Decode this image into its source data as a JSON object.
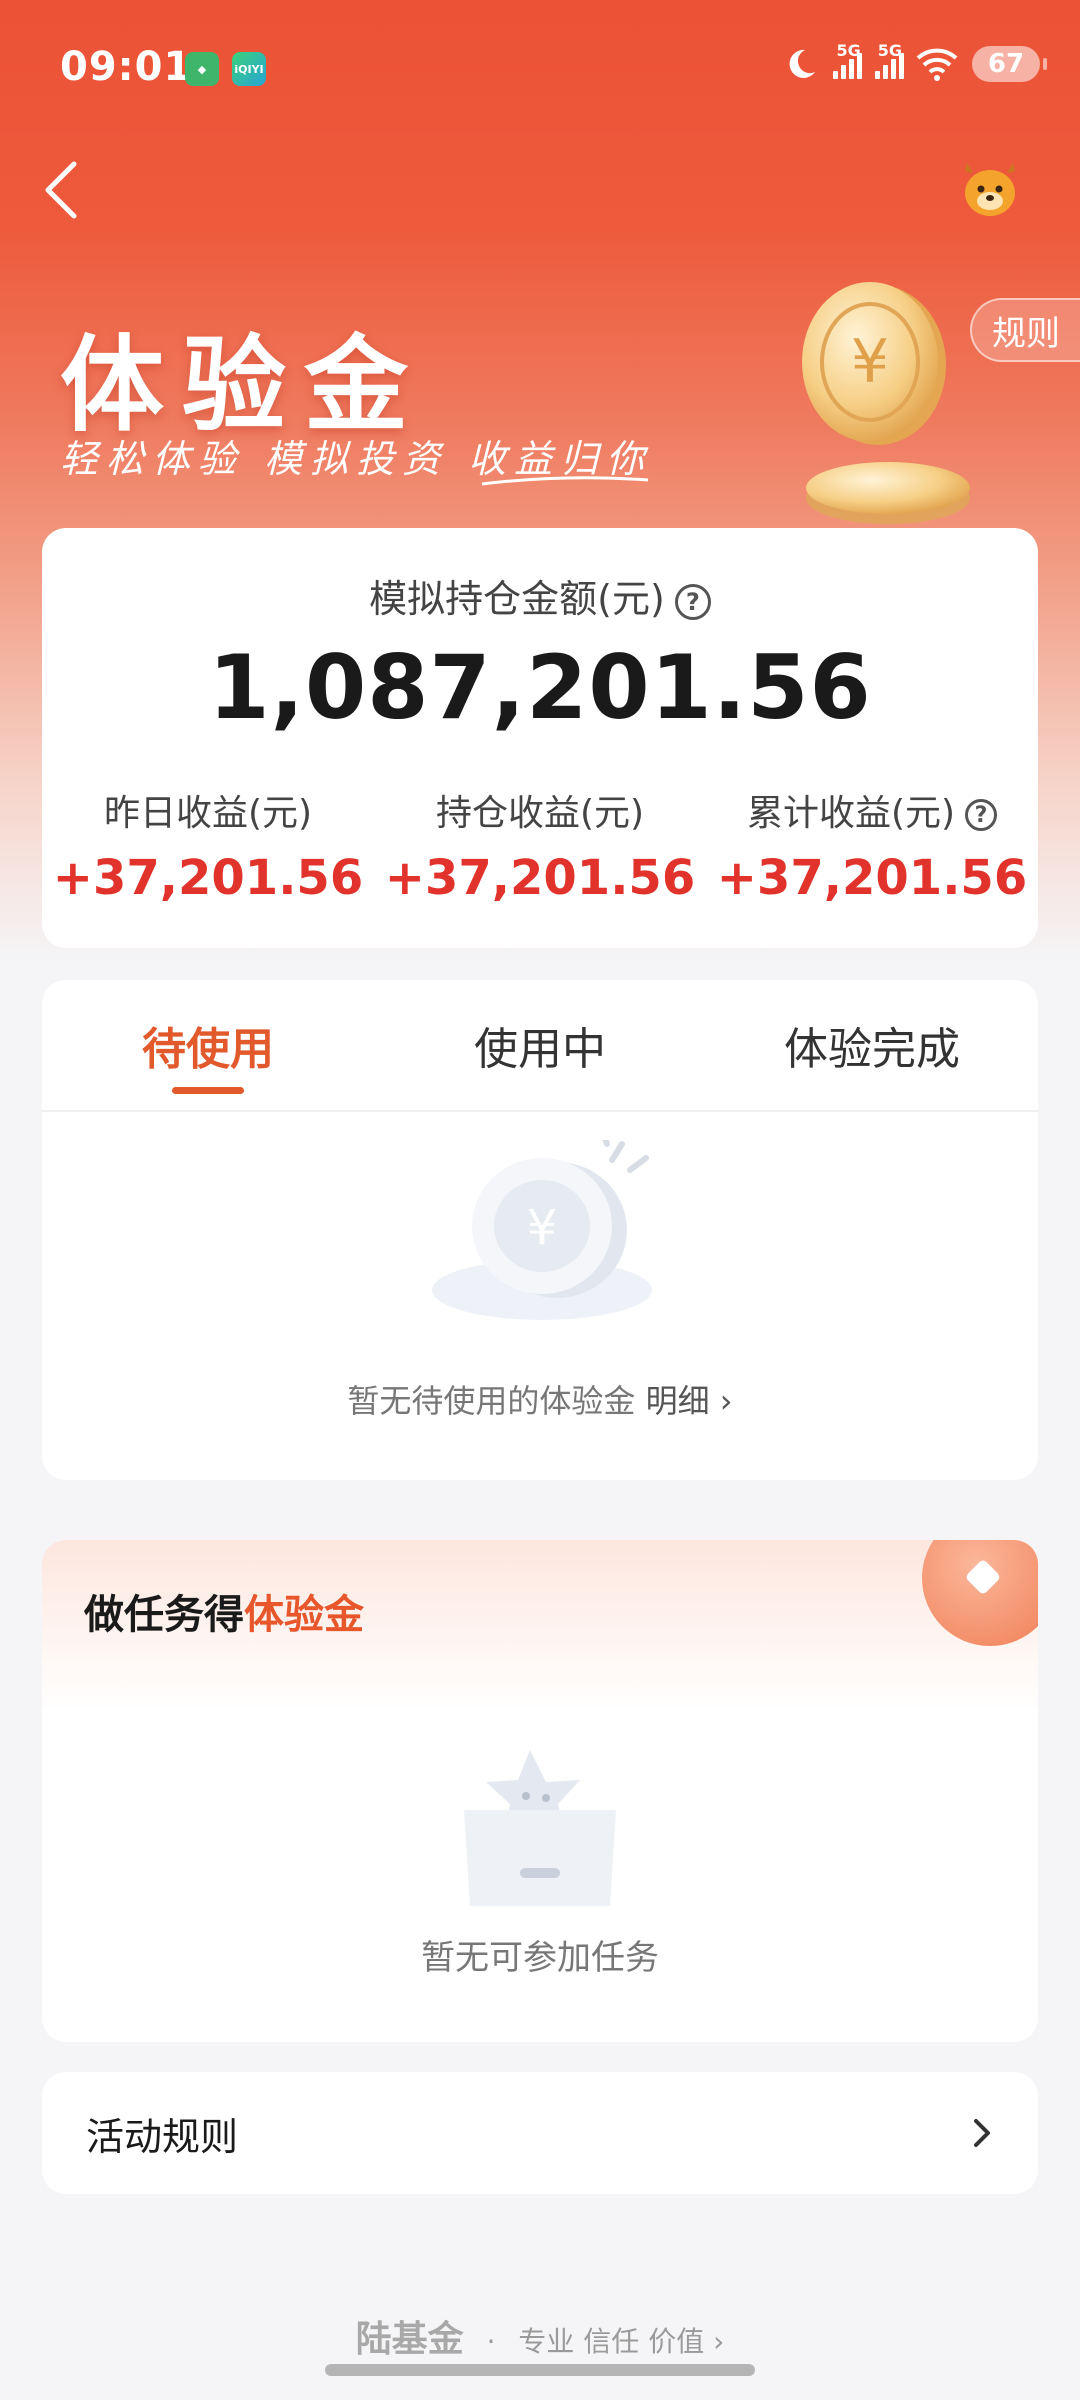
{
  "status_bar": {
    "time": "09:01",
    "app_icons": [
      "app-icon-1",
      "iqiyi-icon"
    ],
    "iqiyi_label": "iQIYI",
    "network_1": "5G",
    "network_2": "5G",
    "battery": "67"
  },
  "nav": {
    "back_icon": "chevron-left-icon",
    "mascot_icon": "deer-mascot-icon"
  },
  "hero": {
    "title": "体验金",
    "subtitle": "轻松体验 模拟投资 收益归你",
    "rules_tag": "规则",
    "coin_icon": "yuan-coin-icon"
  },
  "summary": {
    "label": "模拟持仓金额(元)",
    "help": "?",
    "amount": "1,087,201.56",
    "stats": [
      {
        "label": "昨日收益(元)",
        "value": "+37,201.56"
      },
      {
        "label": "持仓收益(元)",
        "value": "+37,201.56"
      },
      {
        "label": "累计收益(元)",
        "value": "+37,201.56"
      }
    ]
  },
  "tabs": {
    "items": [
      "待使用",
      "使用中",
      "体验完成"
    ],
    "active_index": 0,
    "empty_text": "暂无待使用的体验金",
    "detail_link": "明细",
    "detail_chevron": "›"
  },
  "tasks": {
    "title_prefix": "做任务得",
    "title_highlight": "体验金",
    "empty_text": "暂无可参加任务"
  },
  "rules_row": {
    "label": "活动规则",
    "chevron": "›"
  },
  "footer": {
    "brand": "陆基金",
    "dot": "·",
    "slogan": "专业 信任 价值",
    "chevron": "›"
  },
  "colors": {
    "brand_red": "#ec5236",
    "gain_red": "#e1332b",
    "accent_orange": "#e25a2c"
  }
}
